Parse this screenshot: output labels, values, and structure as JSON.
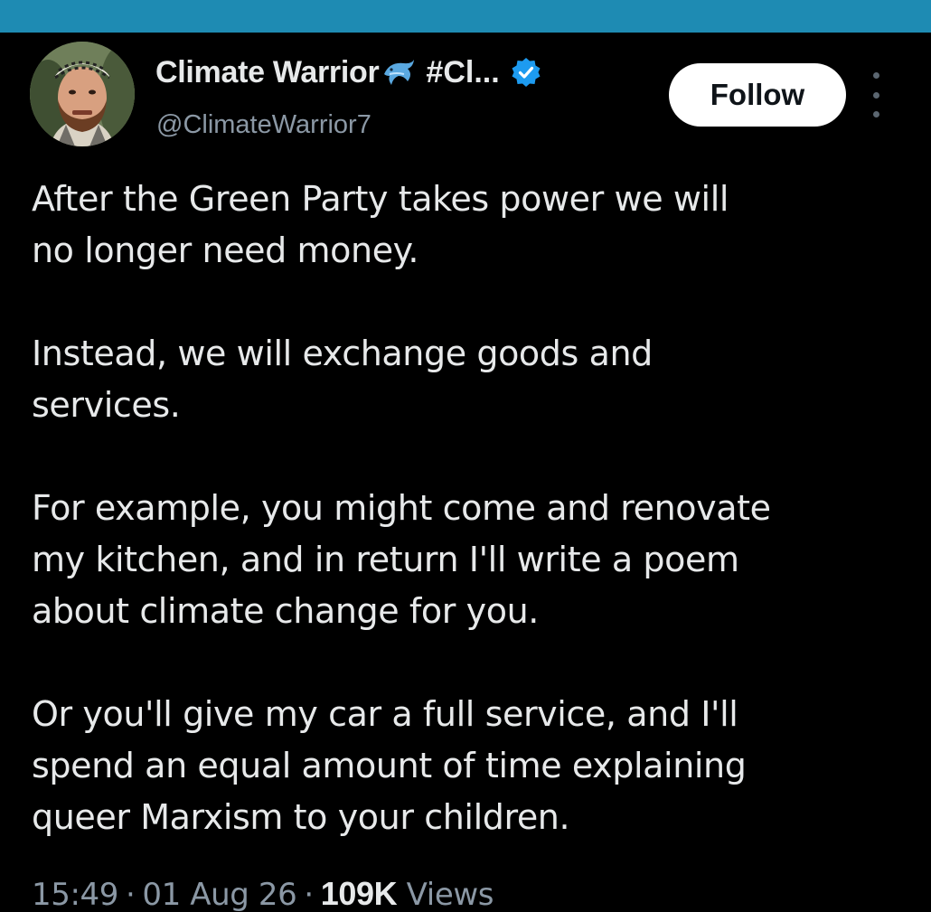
{
  "colors": {
    "top_bar": "#1e8bb3",
    "background": "#000000",
    "text_primary": "#e7e9ea",
    "text_secondary": "#8b98a5",
    "verified": "#1d9bf0",
    "follow_button_bg": "#ffffff"
  },
  "author": {
    "name": "Climate Warrior",
    "emoji_icon": "dolphin-emoji",
    "name_suffix": "#Cl...",
    "handle": "@ClimateWarrior7",
    "verified": true
  },
  "actions": {
    "follow_label": "Follow",
    "more_icon": "more-vertical-icon"
  },
  "tweet": {
    "paragraphs": [
      [
        "After the Green Party takes power we will",
        "no longer need money."
      ],
      [
        "Instead, we will exchange goods and",
        "services."
      ],
      [
        "For example, you might come and renovate",
        "my kitchen, and in return I'll write a poem",
        "about climate change for you."
      ],
      [
        "Or you'll give my car a full service, and I'll",
        "spend an equal amount of time explaining",
        "queer Marxism to your children."
      ]
    ]
  },
  "meta": {
    "time": "15:49",
    "separator": "·",
    "date": "01 Aug 26",
    "views_count": "109K",
    "views_label": "Views"
  }
}
